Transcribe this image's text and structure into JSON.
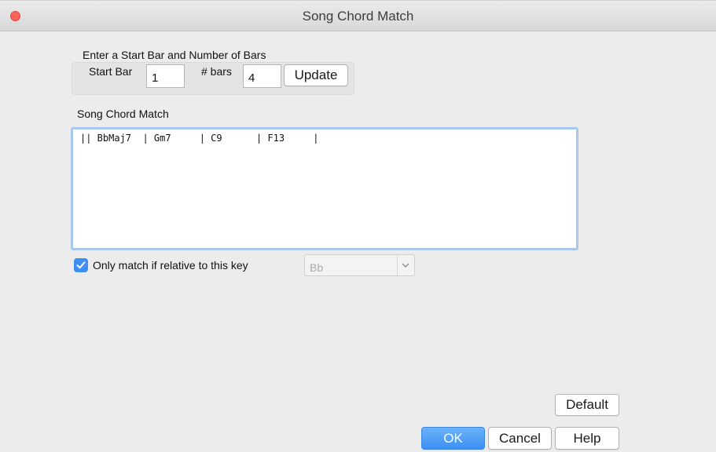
{
  "window": {
    "title": "Song Chord Match"
  },
  "range": {
    "instruction": "Enter a Start Bar and Number of Bars",
    "start_bar_label": "Start Bar",
    "start_bar_value": "1",
    "bars_label": "# bars",
    "bars_value": "4",
    "update_label": "Update"
  },
  "match": {
    "label": "Song Chord Match",
    "chords_text": "|| BbMaj7  | Gm7     | C9      | F13     |"
  },
  "key_option": {
    "checkbox_checked": true,
    "label": "Only match if relative to this  key",
    "key_value": "Bb"
  },
  "buttons": {
    "default": "Default",
    "ok": "OK",
    "cancel": "Cancel",
    "help": "Help"
  },
  "colors": {
    "accent": "#3f8ef5",
    "close": "#fc605b",
    "focus_ring": "#a8c8ef"
  },
  "icons": {
    "close": "close-icon",
    "check": "checkmark-icon",
    "dropdown": "chevron-down-icon"
  }
}
